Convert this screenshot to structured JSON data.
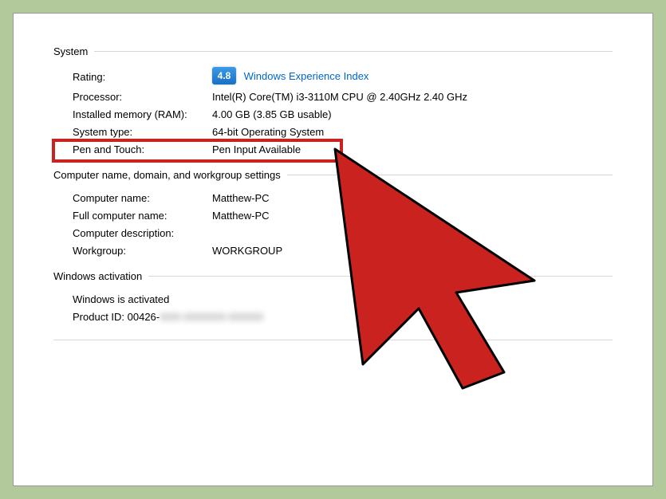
{
  "system": {
    "heading": "System",
    "ratingLabel": "Rating:",
    "ratingScore": "4.8",
    "ratingLink": "Windows Experience Index",
    "processorLabel": "Processor:",
    "processorValue": "Intel(R) Core(TM) i3-3110M CPU @ 2.40GHz   2.40 GHz",
    "ramLabel": "Installed memory (RAM):",
    "ramValue": "4.00 GB (3.85 GB usable)",
    "systemTypeLabel": "System type:",
    "systemTypeValue": "64-bit Operating System",
    "penLabel": "Pen and Touch:",
    "penValue": "Pen Input Available"
  },
  "computer": {
    "heading": "Computer name, domain, and workgroup settings",
    "nameLabel": "Computer name:",
    "nameValue": "Matthew-PC",
    "fullNameLabel": "Full computer name:",
    "fullNameValue": "Matthew-PC",
    "descLabel": "Computer description:",
    "descValue": "",
    "workgroupLabel": "Workgroup:",
    "workgroupValue": "WORKGROUP"
  },
  "activation": {
    "heading": "Windows activation",
    "statusLabel": "Windows is activated",
    "productIdLabel": "Product ID: ",
    "productIdPrefix": "00426-",
    "productIdHidden": "XXX-XXXXXX-XXXXX"
  }
}
